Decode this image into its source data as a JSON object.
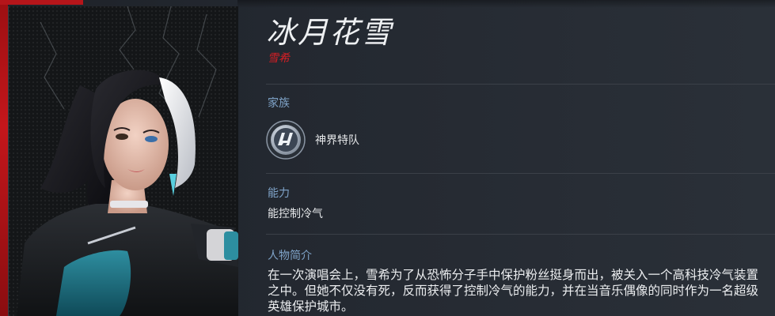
{
  "hero": {
    "name": "冰月花雪",
    "subtitle": "雪希"
  },
  "sections": {
    "family": {
      "label": "家族",
      "value": "神界特队",
      "icon": "faction-emblem-icon"
    },
    "ability": {
      "label": "能力",
      "value": "能控制冷气"
    },
    "bio": {
      "label": "人物简介",
      "text": "在一次演唱会上，雪希为了从恐怖分子手中保护粉丝挺身而出，被关入一个高科技冷气装置之中。但她不仅没有死，反而获得了控制冷气的能力，并在当音乐偶像的同时作为一名超级英雄保护城市。"
    }
  },
  "colors": {
    "accent_red": "#d81e24",
    "label_blue": "#7fa3c8",
    "frame_red": "#c4161b"
  }
}
